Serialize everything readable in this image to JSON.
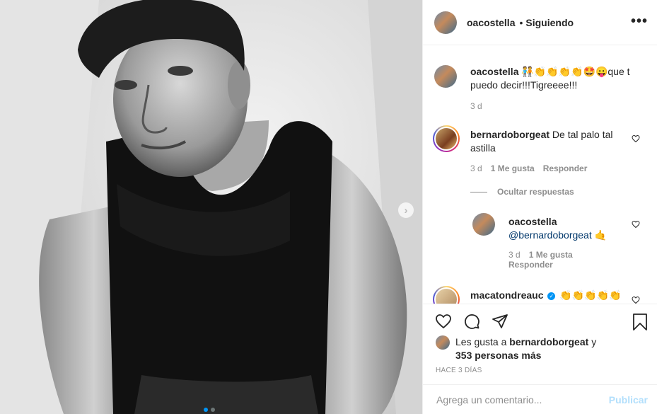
{
  "post": {
    "carousel": {
      "next_arrow": "›",
      "slide_count": 2,
      "active_slide": 0
    }
  },
  "header": {
    "username": "oacostella",
    "separator": "•",
    "follow_status": "Siguiendo",
    "more": "•••"
  },
  "comments": [
    {
      "user": "oacostella",
      "text": "🧑‍🤝‍🧑👏👏👏👏🤩😛que t puedo decir!!!Tigreeee!!!",
      "time": "3 d"
    },
    {
      "user": "bernardoborgeat",
      "text": "De tal palo tal astilla",
      "time": "3 d",
      "likes": "1 Me gusta",
      "reply": "Responder"
    }
  ],
  "replies_toggle": "Ocultar respuestas",
  "reply": {
    "user": "oacostella",
    "mention": "@bernardoborgeat",
    "emoji": "🤙",
    "time": "3 d",
    "likes": "1 Me gusta",
    "reply": "Responder"
  },
  "partial_comment": {
    "user": "macatondreauc",
    "verified": "✓",
    "text": "👏👏👏👏👏"
  },
  "likes_line": {
    "prefix": "Les gusta a",
    "user": "bernardoborgeat",
    "suffix": "y",
    "others": "353 personas más"
  },
  "time_ago": "HACE 3 DÍAS",
  "composer": {
    "placeholder": "Agrega un comentario...",
    "post": "Publicar"
  },
  "colors": {
    "link": "#00376b",
    "accent": "#0095f6",
    "post_disabled": "#b2dffc",
    "meta": "#8e8e8e"
  }
}
